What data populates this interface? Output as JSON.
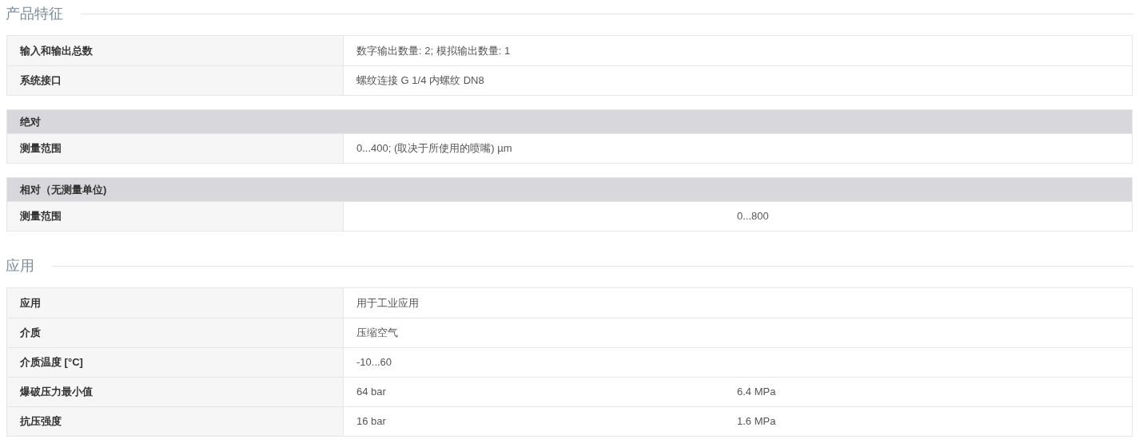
{
  "sections": [
    {
      "title": "产品特征",
      "tables": [
        {
          "rows": [
            {
              "label": "输入和输出总数",
              "value": "数字输出数量: 2; 模拟输出数量: 1"
            },
            {
              "label": "系统接口",
              "value": "螺纹连接 G 1/4 内螺纹 DN8"
            }
          ]
        },
        {
          "heading": "绝对",
          "rows": [
            {
              "label": "测量范围",
              "value": "0...400; (取决于所使用的喷嘴) µm"
            }
          ]
        },
        {
          "heading": "相对（无测量单位)",
          "rows": [
            {
              "label": "测量范围",
              "value_2": "0...800"
            }
          ]
        }
      ]
    },
    {
      "title": "应用",
      "tables": [
        {
          "rows": [
            {
              "label": "应用",
              "value": "用于工业应用"
            },
            {
              "label": "介质",
              "value": "压缩空气"
            },
            {
              "label": "介质温度 [°C]",
              "value": "-10...60"
            },
            {
              "label": "爆破压力最小值",
              "value": "64 bar",
              "value_2": "6.4 MPa"
            },
            {
              "label": "抗压强度",
              "value": "16 bar",
              "value_2": "1.6 MPa"
            }
          ]
        }
      ]
    }
  ]
}
